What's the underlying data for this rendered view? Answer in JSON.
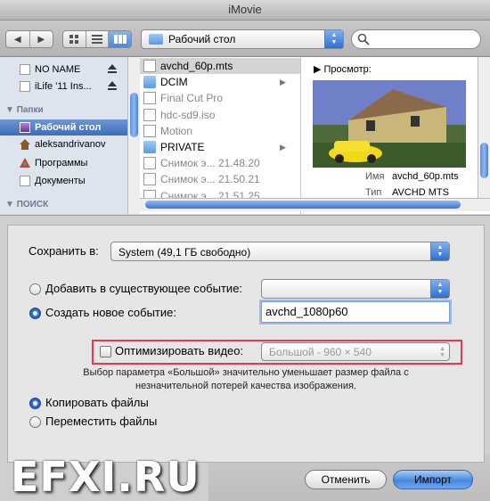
{
  "window": {
    "title": "iMovie"
  },
  "toolbar": {
    "back_icon": "left-arrow-icon",
    "forward_icon": "right-arrow-icon",
    "location": "Рабочий стол"
  },
  "sidebar": {
    "devices": [
      {
        "label": "NO NAME",
        "icon": "disk-icon"
      },
      {
        "label": "iLife '11 Ins...",
        "icon": "disk-icon"
      }
    ],
    "places_header": "Папки",
    "places": [
      {
        "label": "Рабочий стол",
        "icon": "desktop-icon",
        "selected": true
      },
      {
        "label": "aleksandrivanov",
        "icon": "home-icon"
      },
      {
        "label": "Программы",
        "icon": "apps-icon"
      },
      {
        "label": "Документы",
        "icon": "documents-icon"
      }
    ],
    "search_header": "ПОИСК"
  },
  "files": [
    {
      "name": "avchd_60p.mts",
      "kind": "file",
      "highlight": true
    },
    {
      "name": "DCIM",
      "kind": "folder",
      "chevron": "▶"
    },
    {
      "name": "Final Cut Pro",
      "kind": "file",
      "dim": true
    },
    {
      "name": "hdc-sd9.iso",
      "kind": "file",
      "dim": true
    },
    {
      "name": "Motion",
      "kind": "file",
      "dim": true
    },
    {
      "name": "PRIVATE",
      "kind": "folder",
      "chevron": "▶"
    },
    {
      "name": "Снимок э...  21.48.20",
      "kind": "file",
      "dim": true
    },
    {
      "name": "Снимок э...  21.50.21",
      "kind": "file",
      "dim": true
    },
    {
      "name": "Снимок э...  21.51.25",
      "kind": "file",
      "dim": true
    }
  ],
  "preview": {
    "label": "Просмотр:",
    "name_label": "Имя",
    "name_value": "avchd_60p.mts",
    "type_label": "Тип",
    "type_value": "AVCHD MTS"
  },
  "form": {
    "save_in_label": "Сохранить в:",
    "save_in_value": "System (49,1 ГБ свободно)",
    "add_existing_label": "Добавить в существующее событие:",
    "add_existing_value": "",
    "create_new_label": "Создать новое событие:",
    "create_new_value": "avchd_1080p60",
    "optimize_label": "Оптимизировать видео:",
    "optimize_value": "Большой - 960 × 540",
    "note_line1": "Выбор параметра «Большой» значительно уменьшает размер файла с",
    "note_line2": "незначительной потерей качества изображения.",
    "copy_label": "Копировать файлы",
    "move_label": "Переместить файлы"
  },
  "buttons": {
    "cancel": "Отменить",
    "import": "Импорт"
  },
  "watermark": "EFXI.RU",
  "colors": {
    "accent": "#3f6cb8",
    "highlight_box": "#e03b4e"
  }
}
